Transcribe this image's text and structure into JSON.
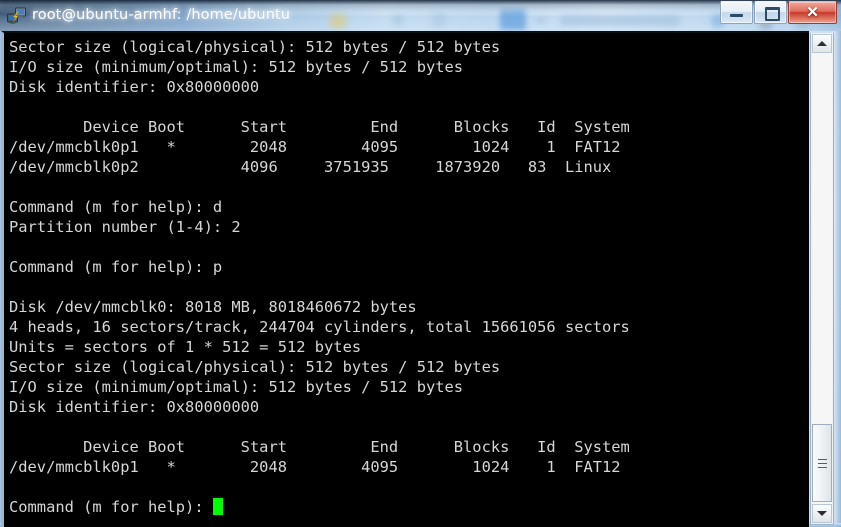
{
  "window": {
    "title": "root@ubuntu-armhf: /home/ubuntu",
    "icon": "putty-icon",
    "controls": {
      "minimize_label": "",
      "maximize_label": "",
      "close_label": "✕"
    }
  },
  "terminal": {
    "foreground_color": "#d6d6d6",
    "background_color": "#000000",
    "cursor_color": "#00ff00",
    "lines": [
      "Sector size (logical/physical): 512 bytes / 512 bytes",
      "I/O size (minimum/optimal): 512 bytes / 512 bytes",
      "Disk identifier: 0x80000000",
      "",
      "        Device Boot      Start         End      Blocks   Id  System",
      "/dev/mmcblk0p1   *        2048        4095        1024    1  FAT12",
      "/dev/mmcblk0p2           4096     3751935     1873920   83  Linux",
      "",
      "Command (m for help): d",
      "Partition number (1-4): 2",
      "",
      "Command (m for help): p",
      "",
      "Disk /dev/mmcblk0: 8018 MB, 8018460672 bytes",
      "4 heads, 16 sectors/track, 244704 cylinders, total 15661056 sectors",
      "Units = sectors of 1 * 512 = 512 bytes",
      "Sector size (logical/physical): 512 bytes / 512 bytes",
      "I/O size (minimum/optimal): 512 bytes / 512 bytes",
      "Disk identifier: 0x80000000",
      "",
      "        Device Boot      Start         End      Blocks   Id  System",
      "/dev/mmcblk0p1   *        2048        4095        1024    1  FAT12",
      "",
      "Command (m for help): "
    ],
    "prompt_cursor_visible": true
  },
  "scrollbar": {
    "up_arrow": "scroll-up-arrow",
    "down_arrow": "scroll-down-arrow",
    "thumb": "scroll-thumb"
  }
}
